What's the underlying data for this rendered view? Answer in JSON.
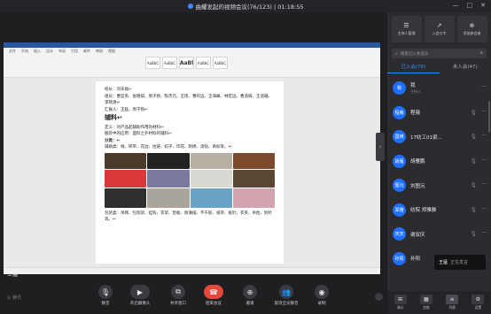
{
  "window": {
    "title": "曲耀发起的视频会议(76/123) | 01:18:55",
    "controls": [
      "—",
      "□",
      "✕"
    ]
  },
  "shared_doc": {
    "ribbon_tabs": [
      "文件",
      "开始",
      "插入",
      "设计",
      "布局",
      "引用",
      "邮件",
      "审阅",
      "视图"
    ],
    "styles": [
      "AaBbC",
      "AaBbC",
      "AaBl",
      "AaBbC",
      "AaBbC"
    ],
    "lines": {
      "l1": "校长：刘天福↩",
      "l2": "组员：曹廷英、张德琪、周子扬、陈杰元、王瑶、曹鸣远、王海峰、林宏远、曹浩辉、王浩珊、李晓源↩",
      "l3": "汇报人：王猛，周子扬↩",
      "heading": "辅料↩",
      "def": "定义：对产品起辅助作用的材料↩",
      "common": "服装中的应用：面料之外材料的辅料↩",
      "cat": "分类：↩",
      "decor": "辅助类：线、织带、花边、拉链、扣子、印花、刺绣、烫钻、商标等。↩",
      "pack": "包装类：吊牌、包装袋、挂钩、衣架、垫板、防潮纸、不干胶、纸带、纸针、衣夹、吊粒、别针等。↩"
    },
    "image_colors": [
      "#4a3b2a",
      "#222222",
      "#b8b0a4",
      "#7b4a2c",
      "#d83838",
      "#7a7aa0",
      "#d9d8d2",
      "#5a4632",
      "#2f2f2f",
      "#aaa59c",
      "#6aa3c8",
      "#d4a3b0"
    ]
  },
  "speaker_tag": "王猛",
  "toolbar": {
    "logo": "◎ 腾讯",
    "buttons": [
      {
        "icon": "🎙",
        "label": "静音"
      },
      {
        "icon": "▶",
        "label": "开启摄像头"
      },
      {
        "icon": "⧉",
        "label": "共享窗口"
      },
      {
        "icon": "☎",
        "label": "结束会议"
      },
      {
        "icon": "⊕",
        "label": "邀请"
      },
      {
        "icon": "👥",
        "label": "取消全员静音"
      },
      {
        "icon": "◉",
        "label": "录制"
      }
    ]
  },
  "panel": {
    "top_buttons": [
      {
        "icon": "☰",
        "label": "主持人管理"
      },
      {
        "icon": "↗",
        "label": "入会口令"
      },
      {
        "icon": "⊕",
        "label": "添加参会者"
      }
    ],
    "search_placeholder": "搜索已入会成员",
    "tabs": [
      "已入会(76)",
      "未入会(47)"
    ],
    "participants": [
      {
        "avatar": "我",
        "name": "我",
        "role": "主持人"
      },
      {
        "avatar": "程薇",
        "name": "程薇",
        "role": ""
      },
      {
        "avatar": "国瑛",
        "name": "17纺工01梁...",
        "role": ""
      },
      {
        "avatar": "胡雁",
        "name": "胡雁鹏",
        "role": ""
      },
      {
        "avatar": "图沅",
        "name": "刘图沅",
        "role": ""
      },
      {
        "avatar": "郑雅",
        "name": "纺院 郑雅雅",
        "role": ""
      },
      {
        "avatar": "庆庆",
        "name": "谢双庆",
        "role": ""
      },
      {
        "avatar": "孙阳",
        "name": "孙阳",
        "role": ""
      }
    ],
    "speaking": {
      "name": "王猛",
      "status": "正在发言"
    },
    "bottom_buttons": [
      {
        "icon": "⊞",
        "label": "演示"
      },
      {
        "icon": "▦",
        "label": "宫格"
      },
      {
        "icon": "≡",
        "label": "列表"
      },
      {
        "icon": "⚙",
        "label": "设置"
      }
    ]
  }
}
